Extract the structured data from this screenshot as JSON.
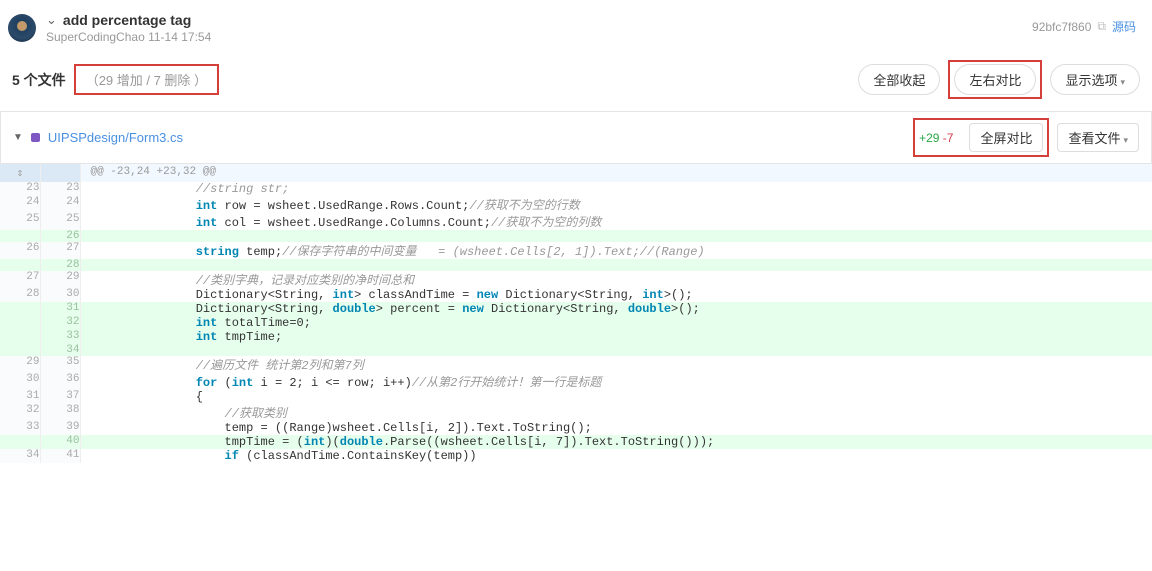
{
  "commit": {
    "title": "add percentage tag",
    "author": "SuperCodingChao",
    "timestamp": "11-14 17:54",
    "hash": "92bfc7f860",
    "source_link": "源码"
  },
  "summary": {
    "files_count": "5 个文件",
    "stats": "（29 增加 / 7 删除 ）"
  },
  "buttons": {
    "collapse_all": "全部收起",
    "side_by_side": "左右对比",
    "display_options": "显示选项",
    "fullscreen": "全屏对比",
    "view_file": "查看文件"
  },
  "file": {
    "path": "UIPSPdesign/Form3.cs",
    "add": "+29",
    "del": "-7"
  },
  "hunk": "@@ -23,24 +23,32 @@",
  "lines": [
    {
      "o": "23",
      "n": "23",
      "t": "n",
      "c": "                //string str;"
    },
    {
      "o": "24",
      "n": "24",
      "t": "n",
      "c": "                int row = wsheet.UsedRange.Rows.Count;//获取不为空的行数"
    },
    {
      "o": "25",
      "n": "25",
      "t": "n",
      "c": "                int col = wsheet.UsedRange.Columns.Count;//获取不为空的列数"
    },
    {
      "o": "",
      "n": "26",
      "t": "a",
      "c": ""
    },
    {
      "o": "26",
      "n": "27",
      "t": "n",
      "c": "                string temp;//保存字符串的中间变量   = (wsheet.Cells[2, 1]).Text;//(Range)"
    },
    {
      "o": "",
      "n": "28",
      "t": "a",
      "c": ""
    },
    {
      "o": "27",
      "n": "29",
      "t": "n",
      "c": "                //类别字典，记录对应类别的净时间总和"
    },
    {
      "o": "28",
      "n": "30",
      "t": "n",
      "c": "                Dictionary<String, int> classAndTime = new Dictionary<String, int>();"
    },
    {
      "o": "",
      "n": "31",
      "t": "a",
      "c": "                Dictionary<String, double> percent = new Dictionary<String, double>();"
    },
    {
      "o": "",
      "n": "32",
      "t": "a",
      "c": "                int totalTime=0;"
    },
    {
      "o": "",
      "n": "33",
      "t": "a",
      "c": "                int tmpTime;"
    },
    {
      "o": "",
      "n": "34",
      "t": "a",
      "c": ""
    },
    {
      "o": "29",
      "n": "35",
      "t": "n",
      "c": "                //遍历文件 统计第2列和第7列"
    },
    {
      "o": "30",
      "n": "36",
      "t": "n",
      "c": "                for (int i = 2; i <= row; i++)//从第2行开始统计！第一行是标题"
    },
    {
      "o": "31",
      "n": "37",
      "t": "n",
      "c": "                {"
    },
    {
      "o": "32",
      "n": "38",
      "t": "n",
      "c": "                    //获取类别"
    },
    {
      "o": "33",
      "n": "39",
      "t": "n",
      "c": "                    temp = ((Range)wsheet.Cells[i, 2]).Text.ToString();"
    },
    {
      "o": "",
      "n": "40",
      "t": "a",
      "c": "                    tmpTime = (int)(double.Parse((wsheet.Cells[i, 7]).Text.ToString()));"
    },
    {
      "o": "34",
      "n": "41",
      "t": "n",
      "c": "                    if (classAndTime.ContainsKey(temp))"
    }
  ]
}
